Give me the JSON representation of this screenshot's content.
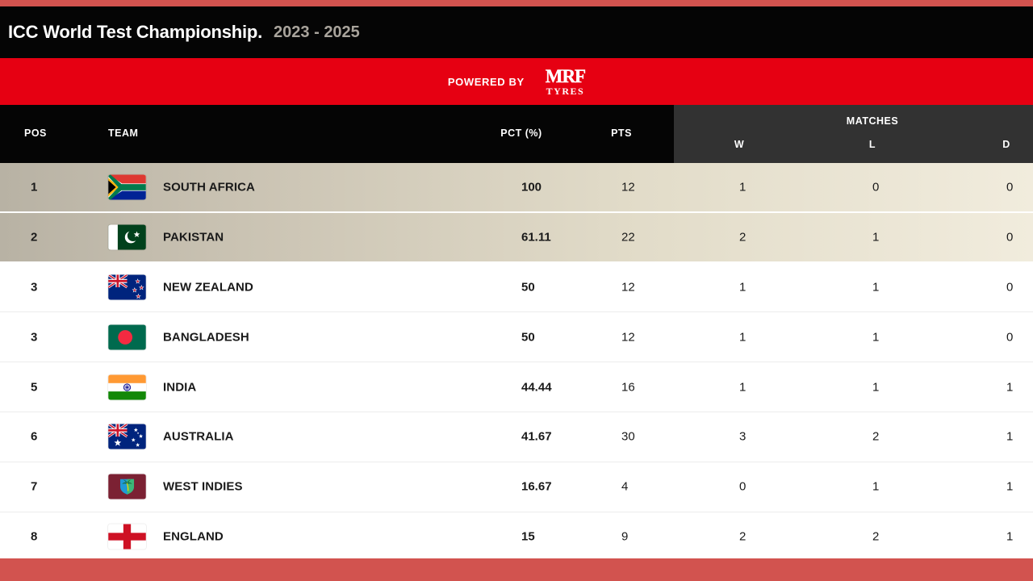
{
  "accent": {
    "band": "#d2534f",
    "red": "#e60012",
    "header_black": "#050505",
    "matches_gray": "#323232",
    "highlight": "#d8d2c2"
  },
  "header": {
    "title": "ICC World Test Championship.",
    "years": "2023 - 2025"
  },
  "sponsor": {
    "powered_label": "POWERED BY",
    "brand_top": "MRF",
    "brand_bottom": "TYRES"
  },
  "table": {
    "columns": {
      "pos": "POS",
      "team": "TEAM",
      "pct": "PCT (%)",
      "pts": "PTS",
      "matches_group": "MATCHES",
      "w": "W",
      "l": "L",
      "d": "D"
    },
    "rows": [
      {
        "pos": "1",
        "team": "SOUTH AFRICA",
        "flag": "flag-south-africa",
        "pct": "100",
        "pts": "12",
        "w": "1",
        "l": "0",
        "d": "0",
        "highlight": true
      },
      {
        "pos": "2",
        "team": "PAKISTAN",
        "flag": "flag-pakistan",
        "pct": "61.11",
        "pts": "22",
        "w": "2",
        "l": "1",
        "d": "0",
        "highlight": true
      },
      {
        "pos": "3",
        "team": "NEW ZEALAND",
        "flag": "flag-new-zealand",
        "pct": "50",
        "pts": "12",
        "w": "1",
        "l": "1",
        "d": "0",
        "highlight": false
      },
      {
        "pos": "3",
        "team": "BANGLADESH",
        "flag": "flag-bangladesh",
        "pct": "50",
        "pts": "12",
        "w": "1",
        "l": "1",
        "d": "0",
        "highlight": false
      },
      {
        "pos": "5",
        "team": "INDIA",
        "flag": "flag-india",
        "pct": "44.44",
        "pts": "16",
        "w": "1",
        "l": "1",
        "d": "1",
        "highlight": false
      },
      {
        "pos": "6",
        "team": "AUSTRALIA",
        "flag": "flag-australia",
        "pct": "41.67",
        "pts": "30",
        "w": "3",
        "l": "2",
        "d": "1",
        "highlight": false
      },
      {
        "pos": "7",
        "team": "WEST INDIES",
        "flag": "flag-west-indies",
        "pct": "16.67",
        "pts": "4",
        "w": "0",
        "l": "1",
        "d": "1",
        "highlight": false
      },
      {
        "pos": "8",
        "team": "ENGLAND",
        "flag": "flag-england",
        "pct": "15",
        "pts": "9",
        "w": "2",
        "l": "2",
        "d": "1",
        "highlight": false
      }
    ]
  }
}
